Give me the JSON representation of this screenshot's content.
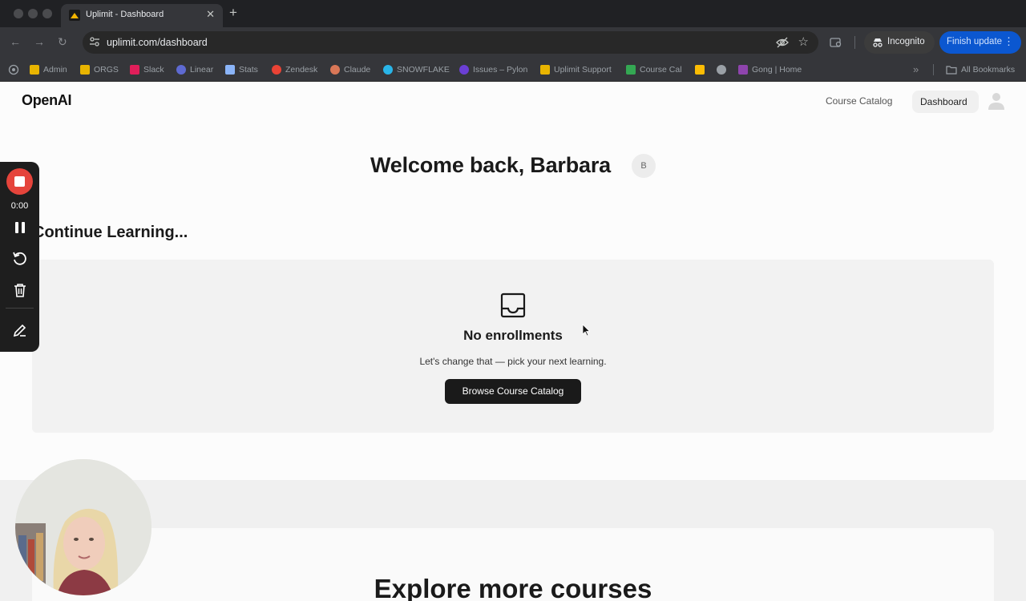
{
  "browser": {
    "tab_title": "Uplimit - Dashboard",
    "tab_close": "✕",
    "new_tab": "+",
    "nav_back": "←",
    "nav_forward": "→",
    "nav_reload": "↻",
    "url": "uplimit.com/dashboard",
    "star": "☆",
    "incognito_label": "Incognito",
    "finish_update_label": "Finish update",
    "menu_dots": "⋮",
    "bookmarks": [
      {
        "label": "Admin",
        "color": "#e8b400"
      },
      {
        "label": "ORGS",
        "color": "#e8b400"
      },
      {
        "label": "Slack",
        "color": "#e01e5a"
      },
      {
        "label": "Linear",
        "color": "#5e6ad2"
      },
      {
        "label": "Stats",
        "color": "#8ab4f8"
      },
      {
        "label": "Zendesk",
        "color": "#ea4335"
      },
      {
        "label": "Claude",
        "color": "#d97757"
      },
      {
        "label": "SNOWFLAKE",
        "color": "#29b5e8"
      },
      {
        "label": "Issues – Pylon",
        "color": "#6b3fd4"
      },
      {
        "label": "Uplimit Support",
        "color": "#e8b400"
      },
      {
        "label": "Course Cal",
        "color": "#34a853"
      },
      {
        "label": "",
        "color": "#fbbc04"
      },
      {
        "label": "",
        "color": "#9aa0a6"
      },
      {
        "label": "Gong | Home",
        "color": "#8e44ad"
      }
    ],
    "bookmarks_more": "»",
    "all_bookmarks": "All Bookmarks"
  },
  "header": {
    "logo": "OpenAI",
    "nav_course_catalog": "Course Catalog",
    "nav_dashboard": "Dashboard"
  },
  "welcome": {
    "title": "Welcome back, Barbara",
    "avatar_initial": "B"
  },
  "continue_learning": {
    "heading": "Continue Learning...",
    "empty_title": "No enrollments",
    "empty_subtitle": "Let's change that — pick your next learning.",
    "button_label": "Browse Course Catalog"
  },
  "explore": {
    "heading": "Explore more courses"
  },
  "recorder": {
    "time": "0:00"
  },
  "colors": {
    "accent_button": "#1a1a1a",
    "record_red": "#e5443b",
    "chrome_update_blue": "#0b57d0"
  }
}
